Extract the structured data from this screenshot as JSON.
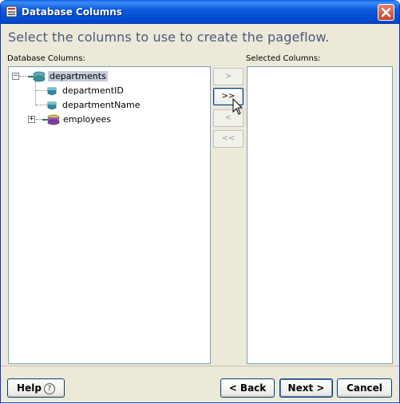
{
  "window": {
    "title": "Database Columns"
  },
  "heading": "Select the columns to use to create the pageflow.",
  "left_panel": {
    "label": "Database Columns:",
    "tree": [
      {
        "label": "departments",
        "type": "table",
        "expanded": true,
        "selected": true
      },
      {
        "label": "departmentID",
        "type": "column"
      },
      {
        "label": "departmentName",
        "type": "column"
      },
      {
        "label": "employees",
        "type": "table",
        "expanded": false
      }
    ]
  },
  "right_panel": {
    "label": "Selected Columns:"
  },
  "move_buttons": {
    "add": ">",
    "add_all": ">>",
    "remove": "<",
    "remove_all": "<<"
  },
  "footer": {
    "help": "Help",
    "help_icon": "?",
    "back": "< Back",
    "next": "Next >",
    "cancel": "Cancel"
  },
  "colors": {
    "title_bar": "#0b5bd9",
    "dialog_bg": "#ece9d8",
    "heading_text": "#4a5a78",
    "selection": "#c3cbd9"
  }
}
